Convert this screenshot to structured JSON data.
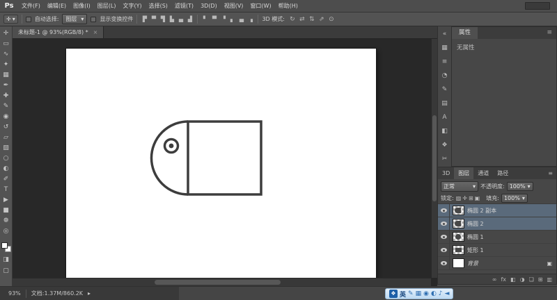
{
  "menubar": {
    "logo": "Ps",
    "menus": [
      "文件(F)",
      "编辑(E)",
      "图像(I)",
      "图层(L)",
      "文字(Y)",
      "选择(S)",
      "滤镜(T)",
      "3D(D)",
      "视图(V)",
      "窗口(W)",
      "帮助(H)"
    ]
  },
  "options": {
    "tool_icon": "✛",
    "auto_select_label": "自动选择:",
    "auto_select_value": "图层",
    "show_transform_label": "显示变换控件",
    "align_icons": [
      "▛",
      "▀",
      "▜",
      "▙",
      "▄",
      "▟"
    ],
    "distribute_icons": [
      "▘",
      "▀",
      "▝",
      "▖",
      "▄",
      "▗"
    ],
    "mode_3d_label": "3D 模式:",
    "mode_3d_icons": [
      "↻",
      "⇄",
      "⇅",
      "⇗",
      "⊙"
    ]
  },
  "toolbar": {
    "tools": [
      "✛",
      "▭",
      "∿",
      "✦",
      "▦",
      "✒",
      "✚",
      "✎",
      "◉",
      "↺",
      "▱",
      "▨",
      "○",
      "◐",
      "✐",
      "T",
      "▶",
      "■",
      "❁",
      "◎"
    ],
    "quick_mask_icon": "◨",
    "screen_mode_icon": "▢"
  },
  "document": {
    "tab_title": "未标题-1 @ 93%(RGB/8) *",
    "close_icon": "×"
  },
  "panel_strip": {
    "icons": [
      "«",
      "▦",
      "≡",
      "◔",
      "✎",
      "▤",
      "A",
      "◧",
      "❖",
      "✂"
    ]
  },
  "properties": {
    "tab": "属性",
    "menu_icon": "≡",
    "empty_text": "无属性"
  },
  "layers": {
    "tabs": [
      "3D",
      "图层",
      "通道",
      "路径"
    ],
    "active_tab": "图层",
    "menu_icon": "≡",
    "blend_mode": "正常",
    "dropdown_arrow": "▾",
    "opacity_label": "不透明度:",
    "opacity_value": "100%",
    "lock_label": "锁定:",
    "lock_icons": [
      "▨",
      "✛",
      "⊞",
      "▣"
    ],
    "fill_label": "填充:",
    "fill_value": "100%",
    "rows": [
      {
        "name": "椭圆 2 副本",
        "selected": true
      },
      {
        "name": "椭圆 2",
        "selected": true
      },
      {
        "name": "椭圆 1",
        "selected": false
      },
      {
        "name": "矩形 1",
        "selected": false
      },
      {
        "name": "背景",
        "selected": false,
        "lock": "▣"
      }
    ],
    "footer_icons": [
      "∞",
      "fx",
      "◧",
      "◑",
      "❏",
      "⊞",
      "▥"
    ]
  },
  "statusbar": {
    "zoom": "93%",
    "doc_info": "文档:1.37M/860.2K",
    "arrow": "▸"
  },
  "taskbar": {
    "app_icon": "❖",
    "lang_indicator": "英",
    "icons": [
      "✎",
      "▦",
      "◉",
      "◐",
      "♪",
      "◄"
    ]
  }
}
